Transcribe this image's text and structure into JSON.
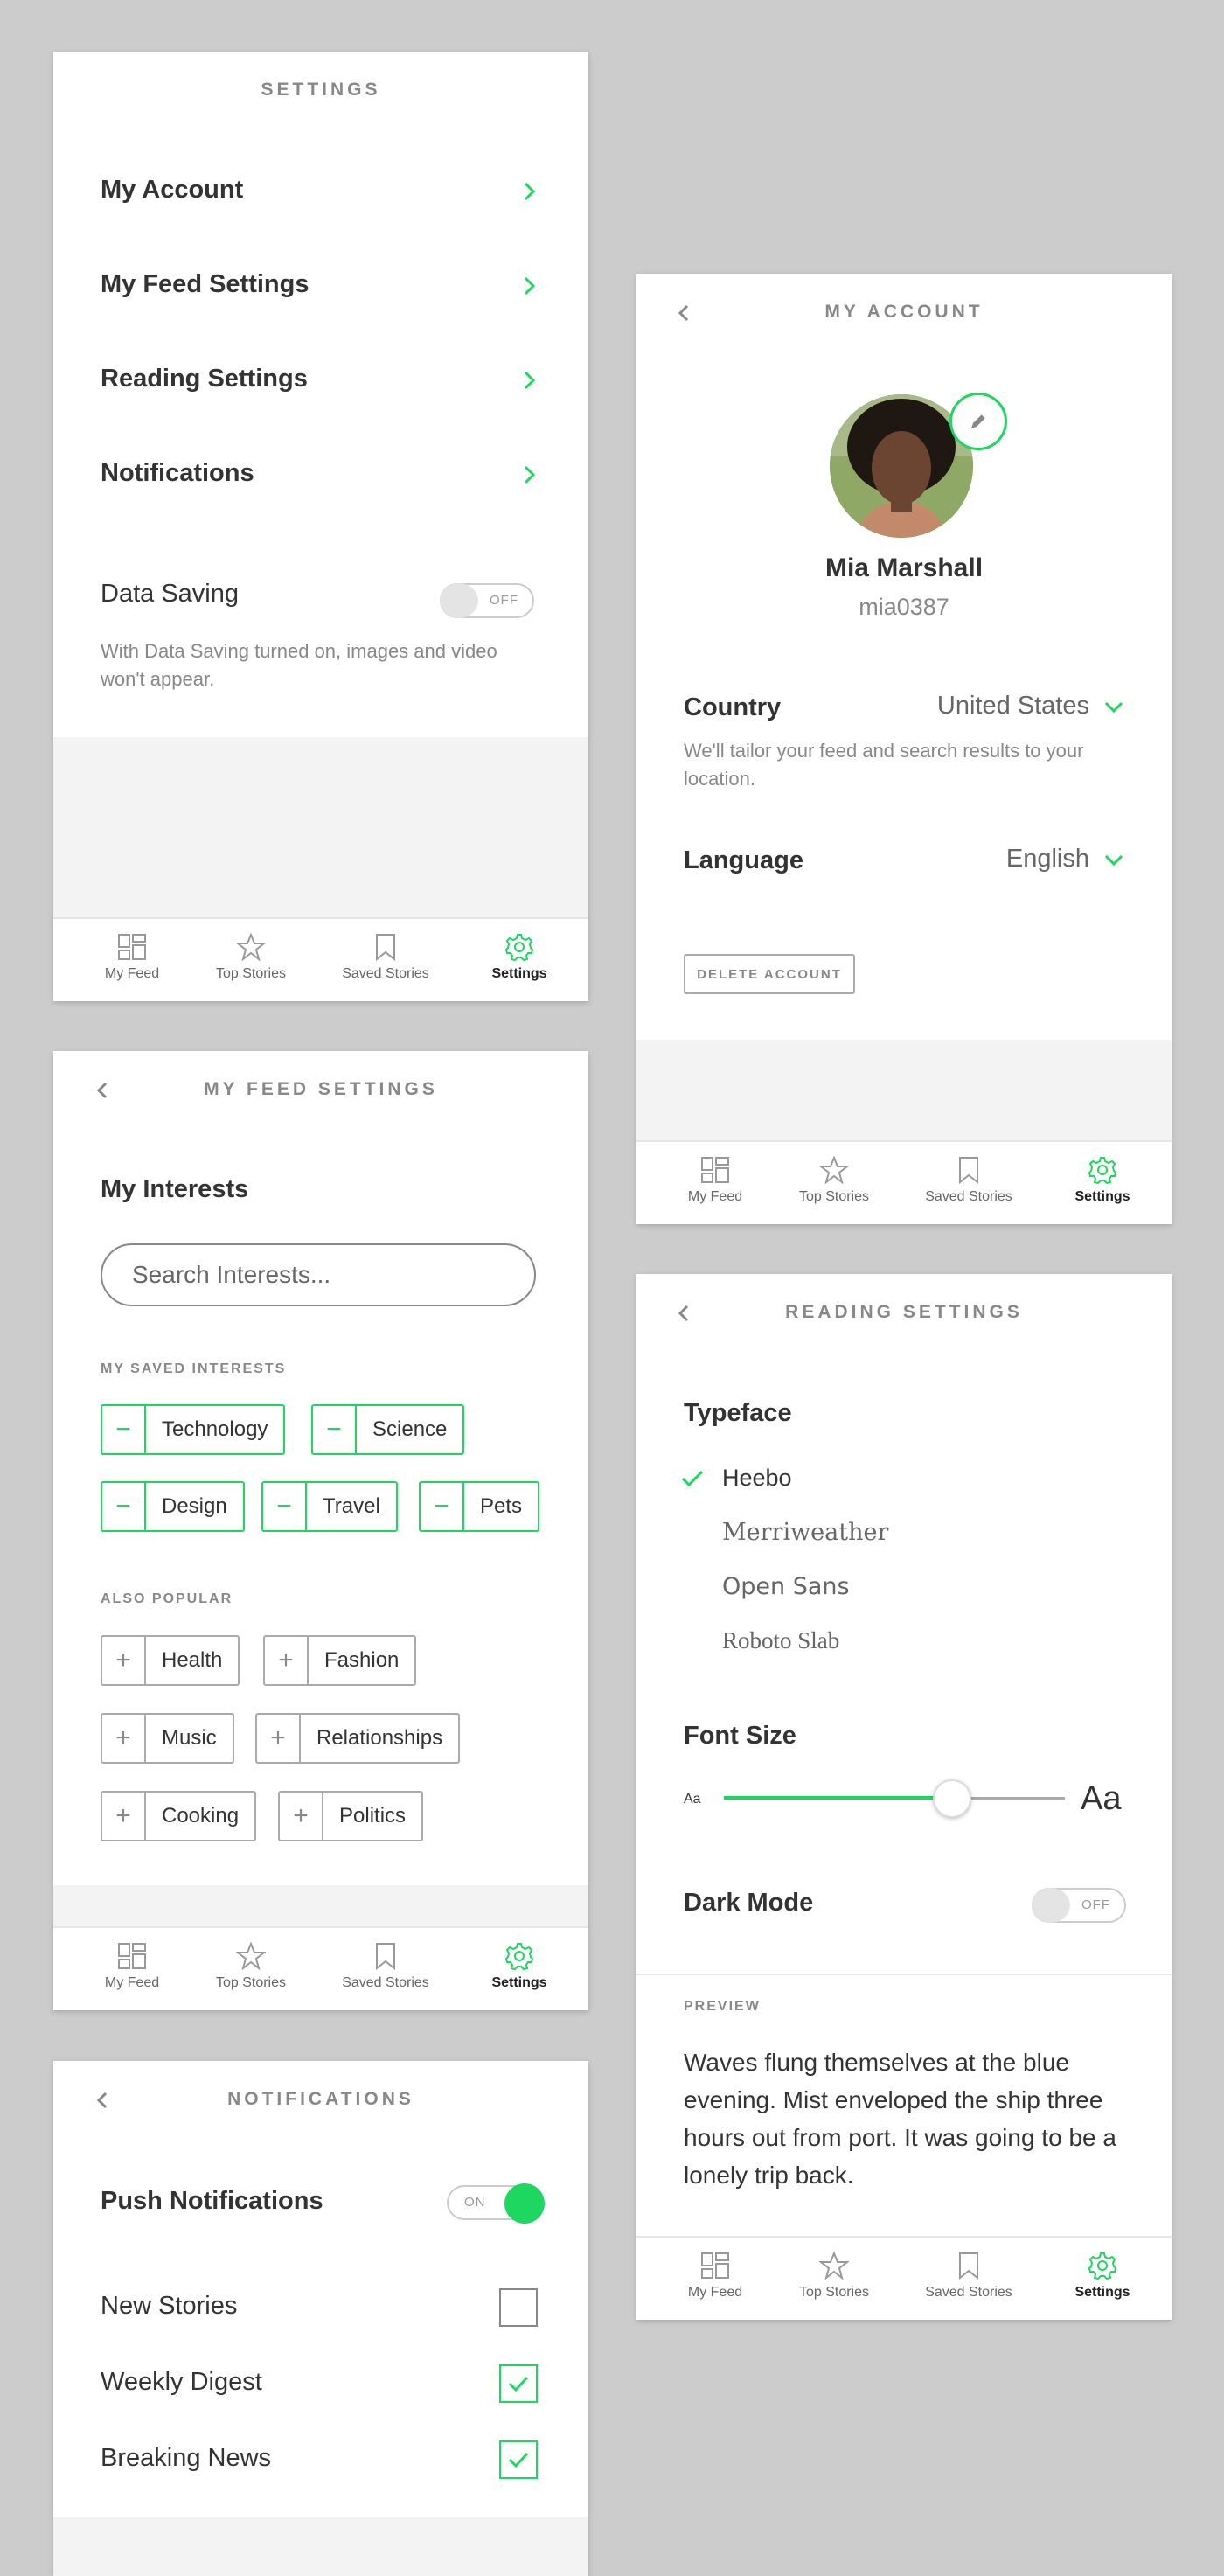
{
  "colors": {
    "accent": "#1ed760",
    "background": "#cccccc",
    "panel": "#f3f3f3"
  },
  "tabs": [
    {
      "label": "My Feed",
      "icon": "grid-icon"
    },
    {
      "label": "Top Stories",
      "icon": "star-icon"
    },
    {
      "label": "Saved Stories",
      "icon": "bookmark-icon"
    },
    {
      "label": "Settings",
      "icon": "gear-icon",
      "active": true
    }
  ],
  "settings": {
    "title": "SETTINGS",
    "items": [
      {
        "label": "My Account"
      },
      {
        "label": "My Feed Settings"
      },
      {
        "label": "Reading Settings"
      },
      {
        "label": "Notifications"
      }
    ],
    "data_saving": {
      "label": "Data Saving",
      "toggle": "OFF",
      "description": "With Data Saving turned on, images and video won't appear."
    }
  },
  "account": {
    "title": "MY ACCOUNT",
    "name": "Mia Marshall",
    "username": "mia0387",
    "country": {
      "label": "Country",
      "value": "United States",
      "note": "We'll tailor your feed and search results to your location."
    },
    "language": {
      "label": "Language",
      "value": "English"
    },
    "delete_label": "DELETE ACCOUNT"
  },
  "feed": {
    "title": "MY FEED SETTINGS",
    "interests_heading": "My Interests",
    "search_placeholder": "Search Interests...",
    "saved_caption": "MY SAVED INTERESTS",
    "saved": [
      "Technology",
      "Science",
      "Design",
      "Travel",
      "Pets"
    ],
    "popular_caption": "ALSO POPULAR",
    "popular": [
      "Health",
      "Fashion",
      "Music",
      "Relationships",
      "Cooking",
      "Politics"
    ]
  },
  "reading": {
    "title": "READING SETTINGS",
    "typeface_heading": "Typeface",
    "typefaces": [
      "Heebo",
      "Merriweather",
      "Open Sans",
      "Roboto Slab"
    ],
    "selected_typeface": "Heebo",
    "font_size_heading": "Font Size",
    "font_size_small": "Aa",
    "font_size_large": "Aa",
    "font_size_level": 0.67,
    "dark_mode": {
      "label": "Dark Mode",
      "toggle": "OFF"
    },
    "preview_caption": "PREVIEW",
    "preview_text": "Waves flung themselves at the blue evening. Mist enveloped the ship three hours out from port. It was going to be a lonely trip back."
  },
  "notifications": {
    "title": "NOTIFICATIONS",
    "push": {
      "label": "Push Notifications",
      "toggle": "ON"
    },
    "items": [
      {
        "label": "New Stories",
        "checked": false
      },
      {
        "label": "Weekly Digest",
        "checked": true
      },
      {
        "label": "Breaking News",
        "checked": true
      }
    ]
  }
}
